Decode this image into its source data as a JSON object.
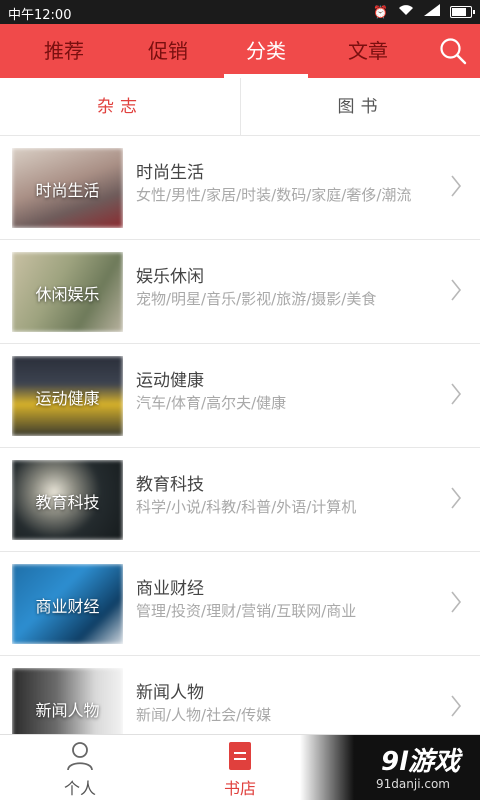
{
  "status_bar": {
    "time": "中午12:00"
  },
  "top_nav": {
    "tabs": [
      "推荐",
      "促销",
      "分类",
      "文章"
    ],
    "active_index": 2
  },
  "sub_tabs": [
    "杂志",
    "图书"
  ],
  "categories": [
    {
      "thumb_label": "时尚生活",
      "title": "时尚生活",
      "subtitle": "女性/男性/家居/时装/数码/家庭/奢侈/潮流"
    },
    {
      "thumb_label": "休闲娱乐",
      "title": "娱乐休闲",
      "subtitle": "宠物/明星/音乐/影视/旅游/摄影/美食"
    },
    {
      "thumb_label": "运动健康",
      "title": "运动健康",
      "subtitle": "汽车/体育/高尔夫/健康"
    },
    {
      "thumb_label": "教育科技",
      "title": "教育科技",
      "subtitle": "科学/小说/科教/科普/外语/计算机"
    },
    {
      "thumb_label": "商业财经",
      "title": "商业财经",
      "subtitle": "管理/投资/理财/营销/互联网/商业"
    },
    {
      "thumb_label": "新闻人物",
      "title": "新闻人物",
      "subtitle": "新闻/人物/社会/传媒"
    }
  ],
  "bottom_nav": {
    "personal": "个人",
    "bookstore": "书店"
  },
  "watermark": {
    "main": "9l游戏",
    "sub": "91danji.com"
  },
  "colors": {
    "accent": "#f04a4a",
    "active_text": "#e0403d"
  }
}
